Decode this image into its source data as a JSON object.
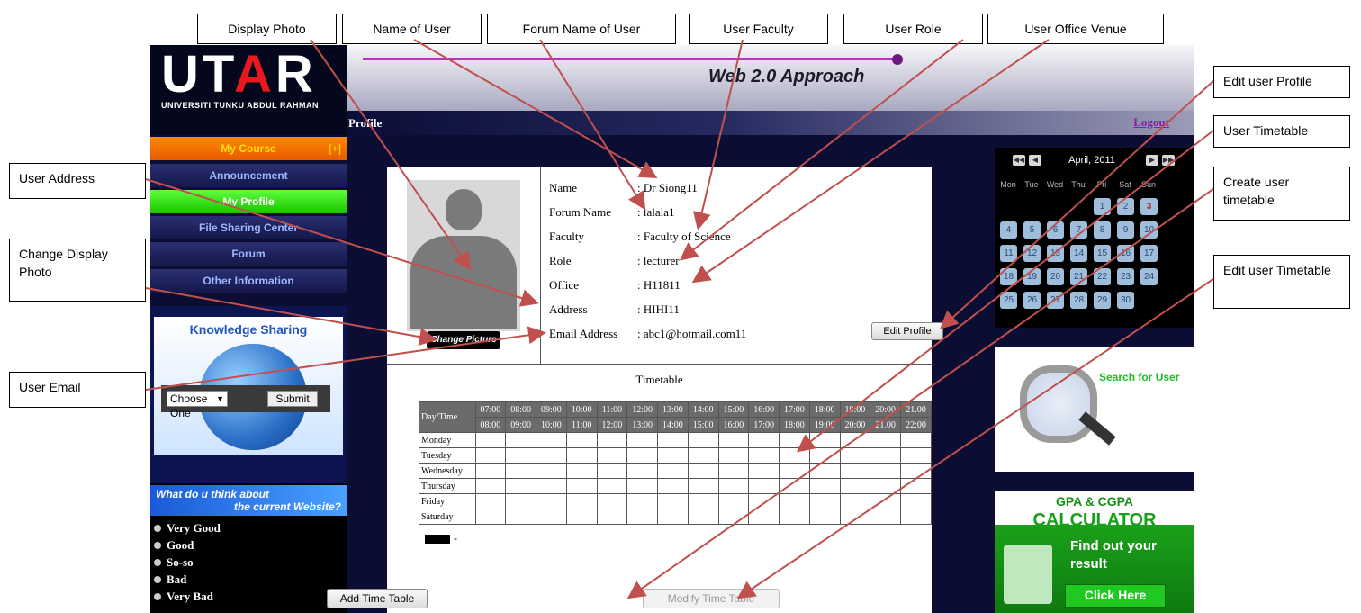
{
  "callouts": {
    "display_photo": "Display Photo",
    "name_of_user": "Name of User",
    "forum_name_of_user": "Forum Name of User",
    "user_faculty": "User Faculty",
    "user_role": "User Role",
    "user_office_venue": "User Office Venue",
    "edit_user_profile": "Edit user Profile",
    "user_timetable": "User Timetable",
    "create_user_timetable": "Create user timetable",
    "edit_user_timetable": "Edit user Timetable",
    "user_address": "User Address",
    "change_display_photo": "Change Display Photo",
    "user_email": "User Email"
  },
  "logo": {
    "text_u": "UT",
    "text_a": "A",
    "text_r": "R",
    "subtitle": "UNIVERSITI TUNKU ABDUL RAHMAN"
  },
  "header": {
    "title": "Web 2.0 Approach",
    "page_label": "Profile",
    "logout": "Logout"
  },
  "nav": {
    "my_course": "My Course",
    "my_course_toggle": "[+]",
    "items": [
      "Announcement",
      "My Profile",
      "File Sharing Center",
      "Forum",
      "Other Information"
    ]
  },
  "knowledge_sharing": {
    "title": "Knowledge Sharing",
    "select_value": "Choose One",
    "submit": "Submit"
  },
  "poll": {
    "question_line1": "What do u think about",
    "question_line2": "the current Website?",
    "options": [
      "Very Good",
      "Good",
      "So-so",
      "Bad",
      "Very Bad"
    ]
  },
  "profile": {
    "change_picture": "Change Picture",
    "fields": [
      {
        "label": "Name",
        "value": ": Dr Siong11"
      },
      {
        "label": "Forum Name",
        "value": ": lalala1"
      },
      {
        "label": "Faculty",
        "value": ": Faculty of Science"
      },
      {
        "label": "Role",
        "value": ": lecturer"
      },
      {
        "label": "Office",
        "value": ": H11811"
      },
      {
        "label": "Address",
        "value": ": HIHI11"
      },
      {
        "label": "Email Address",
        "value": ": abc1@hotmail.com11"
      }
    ],
    "edit_profile": "Edit Profile"
  },
  "timetable": {
    "title": "Timetable",
    "corner_header": "Day/Time",
    "start_times": [
      "07:00",
      "08:00",
      "09:00",
      "10:00",
      "11:00",
      "12:00",
      "13:00",
      "14:00",
      "15:00",
      "16:00",
      "17:00",
      "18:00",
      "19:00",
      "20:00",
      "21.00"
    ],
    "end_times": [
      "08:00",
      "09:00",
      "10:00",
      "11:00",
      "12:00",
      "13:00",
      "14:00",
      "15:00",
      "16:00",
      "17:00",
      "18:00",
      "19:00",
      "20:00",
      "21.00",
      "22:00"
    ],
    "days": [
      "Monday",
      "Tuesday",
      "Wednesday",
      "Thursday",
      "Friday",
      "Saturday"
    ],
    "legend_text": "-",
    "add_button": "Add Time Table",
    "modify_button": "Modify Time Table"
  },
  "calendar": {
    "month": "April, 2011",
    "nav": {
      "prev_year": "◀◀",
      "prev_month": "◀",
      "next_month": "▶",
      "next_year": "▶▶"
    },
    "weekdays": [
      "Mon",
      "Tue",
      "Wed",
      "Thu",
      "Fri",
      "Sat",
      "Sun"
    ],
    "days": [
      "1",
      "2",
      "3",
      "4",
      "5",
      "6",
      "7",
      "8",
      "9",
      "10",
      "11",
      "12",
      "13",
      "14",
      "15",
      "16",
      "17",
      "18",
      "19",
      "20",
      "21",
      "22",
      "23",
      "24",
      "25",
      "26",
      "27",
      "28",
      "29",
      "30"
    ],
    "highlight_day": "3",
    "colors": {
      "day_bg": "#9fbedc",
      "highlight": "#c0202a"
    }
  },
  "search_users": {
    "title": "Search for User"
  },
  "gpa": {
    "line1": "GPA & CGPA",
    "line2": "CALCULATOR",
    "line3": "Find out your result",
    "button": "Click Here"
  },
  "colors": {
    "arrow": "#c0504d",
    "accent_orange": "#ff8a00",
    "accent_green": "#19c300",
    "nav_dark": "#14184a"
  }
}
